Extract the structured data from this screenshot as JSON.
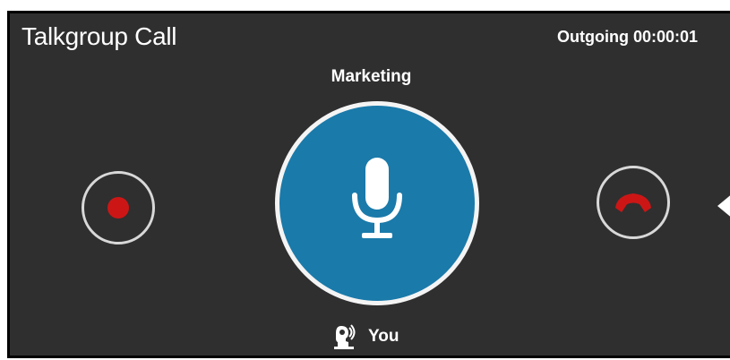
{
  "call": {
    "title": "Talkgroup Call",
    "status": "Outgoing 00:00:01",
    "group_name": "Marketing"
  },
  "controls": {
    "record_icon": "record-icon",
    "mic_icon": "microphone-icon",
    "hangup_icon": "phone-hangup-icon",
    "side_icon": "caret-left-icon"
  },
  "speaker": {
    "icon": "speaking-person-icon",
    "label": "You"
  },
  "colors": {
    "background": "#2f2f2f",
    "mic_button": "#1a7aaa",
    "record": "#cc1616",
    "hangup": "#cc1616",
    "ring": "#d8d8d8"
  }
}
